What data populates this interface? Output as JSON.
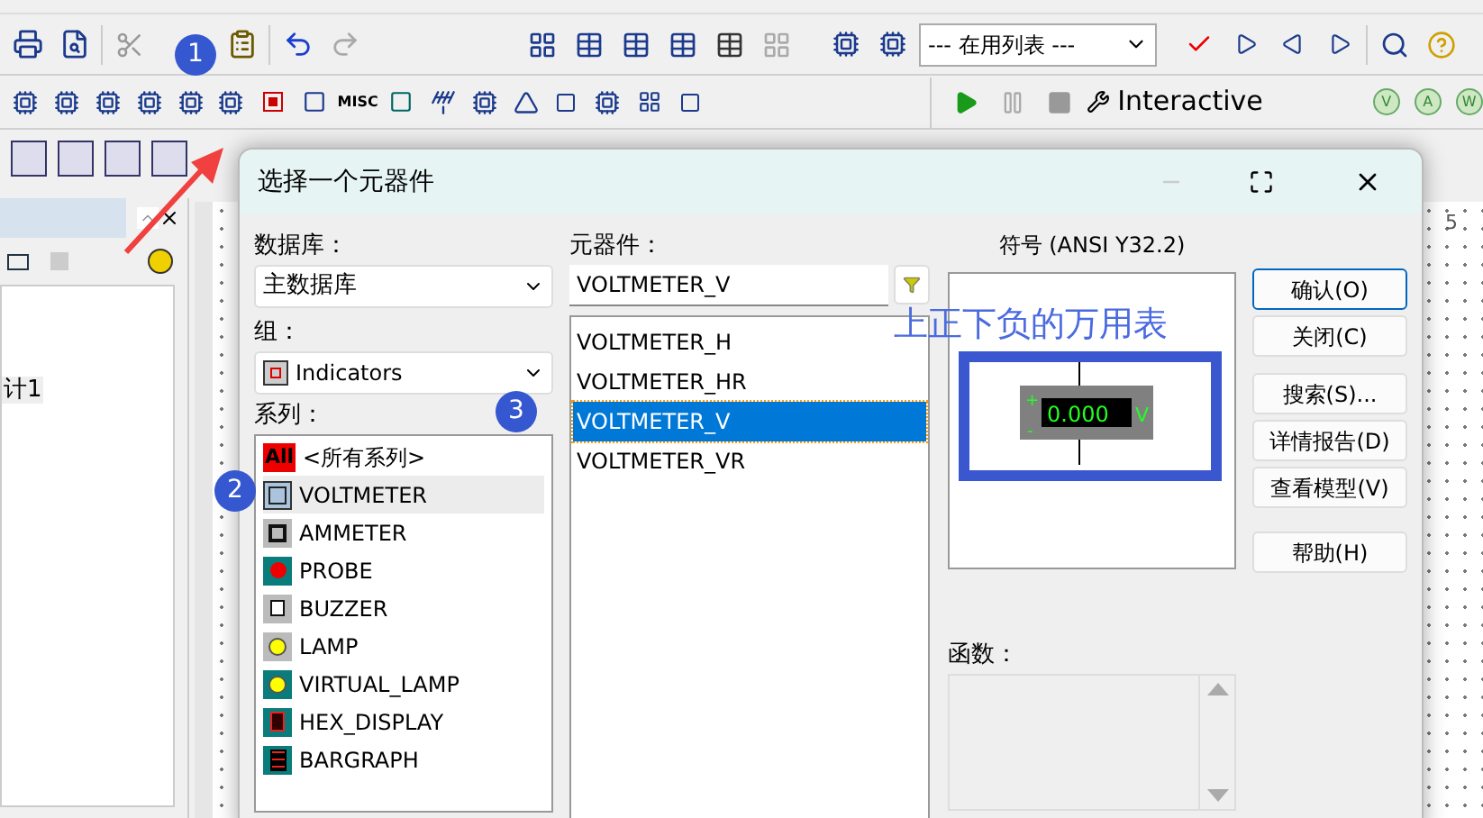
{
  "toolbar": {
    "list_dropdown": "--- 在用列表 ---"
  },
  "component_toolbar": {
    "misc_label": "MISC"
  },
  "simulation_toolbar": {
    "mode": "Interactive"
  },
  "instrument_toolbar": [
    "V",
    "A",
    "W"
  ],
  "design_tree": {
    "item": "计1"
  },
  "ruler": {
    "mark": "5"
  },
  "dialog": {
    "title": "选择一个元器件",
    "database_label": "数据库：",
    "database": "主数据库",
    "group_label": "组：",
    "group": "Indicators",
    "family_label": "系列：",
    "families": [
      {
        "kind": "all",
        "badge": "All",
        "label": "<所有系列>",
        "selected": false
      },
      {
        "kind": "voltmeter",
        "label": "VOLTMETER",
        "selected": true
      },
      {
        "kind": "ammeter",
        "label": "AMMETER",
        "selected": false
      },
      {
        "kind": "probe",
        "label": "PROBE",
        "selected": false
      },
      {
        "kind": "buzzer",
        "label": "BUZZER",
        "selected": false
      },
      {
        "kind": "lamp",
        "label": "LAMP",
        "selected": false
      },
      {
        "kind": "virtual_lamp",
        "label": "VIRTUAL_LAMP",
        "selected": false
      },
      {
        "kind": "hex_display",
        "label": "HEX_DISPLAY",
        "selected": false
      },
      {
        "kind": "bargraph",
        "label": "BARGRAPH",
        "selected": false
      }
    ],
    "component_label": "元器件：",
    "component_value": "VOLTMETER_V",
    "components": [
      {
        "label": "VOLTMETER_H",
        "selected": false
      },
      {
        "label": "VOLTMETER_HR",
        "selected": false
      },
      {
        "label": "VOLTMETER_V",
        "selected": true
      },
      {
        "label": "VOLTMETER_VR",
        "selected": false
      }
    ],
    "symbol_label": "符号 (ANSI Y32.2)",
    "symbol": {
      "reading": "0.000",
      "unit": "V",
      "plus": "+",
      "minus": "-"
    },
    "function_label": "函数：",
    "buttons": [
      {
        "label": "确认(O)",
        "default": true
      },
      {
        "label": "关闭(C)",
        "default": false
      },
      {
        "label": "搜索(S)...",
        "default": false
      },
      {
        "label": "详情报告(D)",
        "default": false
      },
      {
        "label": "查看模型(V)",
        "default": false
      },
      {
        "label": "帮助(H)",
        "default": false
      }
    ]
  },
  "annotations": {
    "steps": [
      "1",
      "2",
      "3"
    ],
    "note": "上正下负的万用表"
  }
}
